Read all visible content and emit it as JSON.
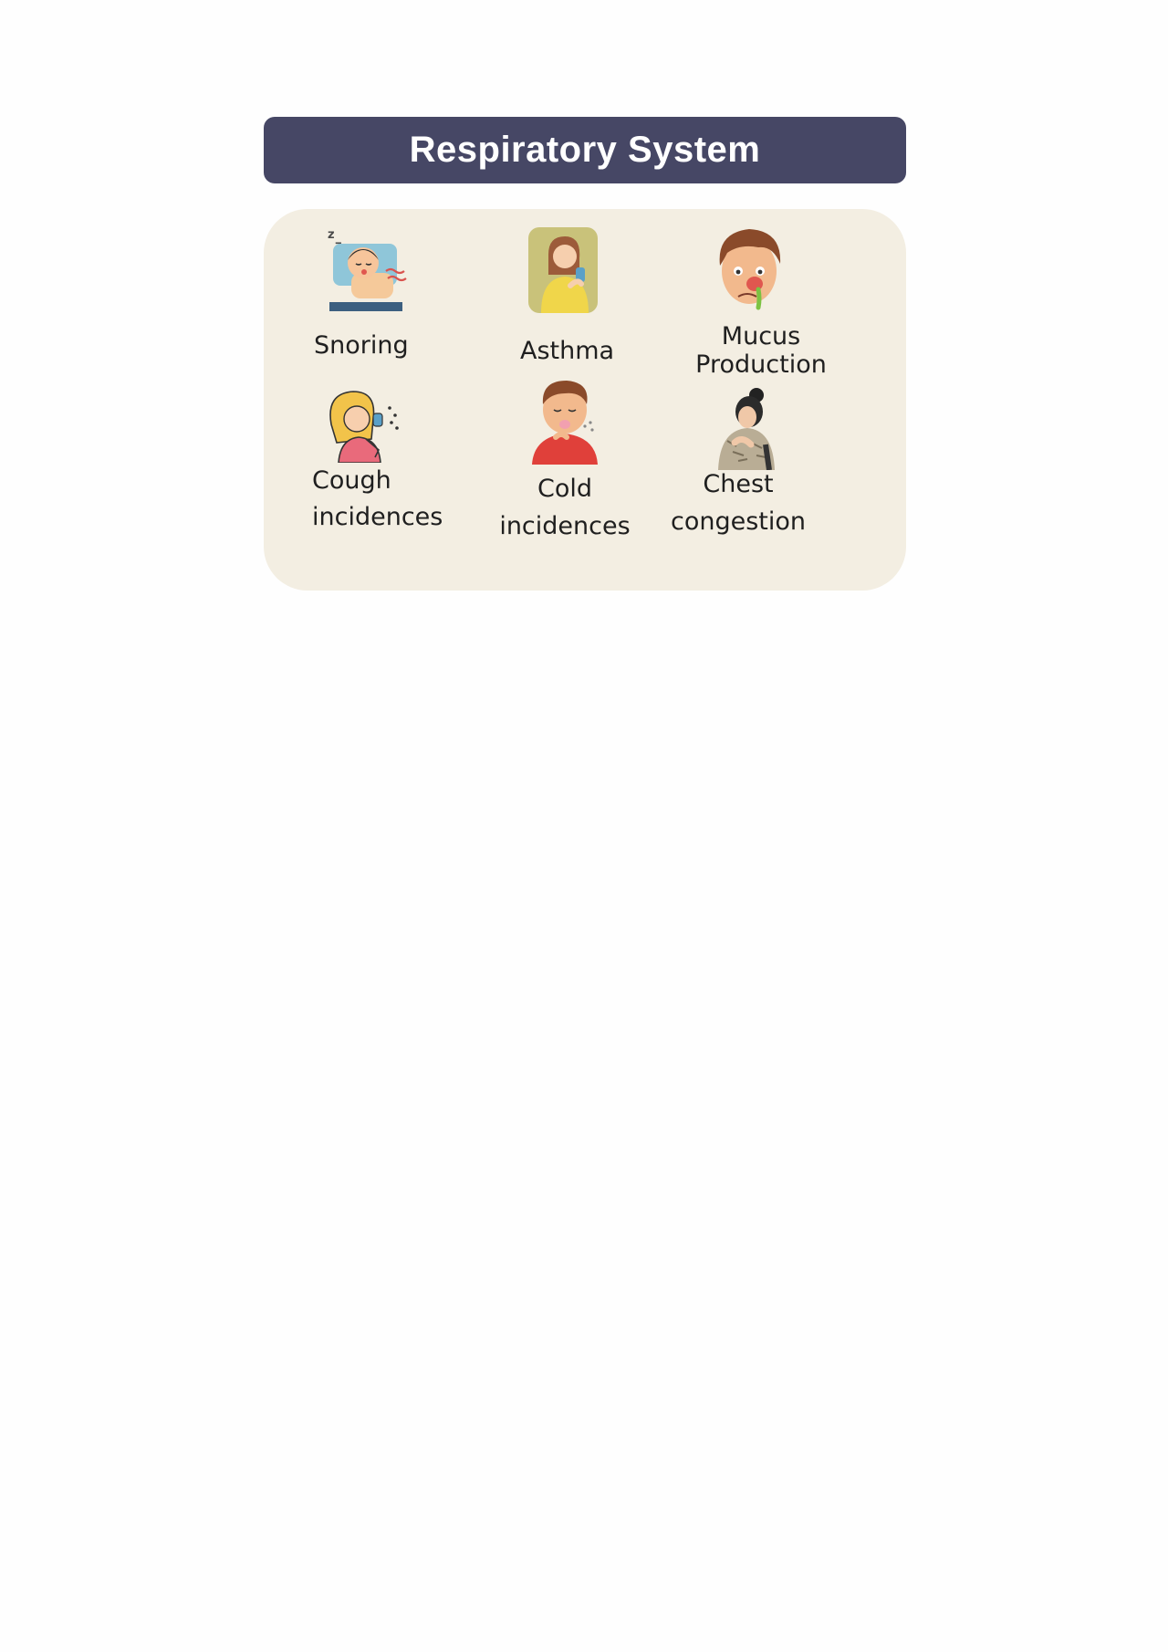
{
  "header": {
    "title": "Respiratory System"
  },
  "items": [
    {
      "icon": "snoring-icon",
      "label_lines": [
        "Snoring"
      ]
    },
    {
      "icon": "asthma-inhaler-icon",
      "label_lines": [
        "Asthma"
      ]
    },
    {
      "icon": "runny-nose-icon",
      "label_lines": [
        "Mucus",
        "Production"
      ]
    },
    {
      "icon": "coughing-woman-icon",
      "label_lines": [
        "Cough",
        "incidences"
      ]
    },
    {
      "icon": "sneezing-man-icon",
      "label_lines": [
        "Cold",
        "incidences"
      ]
    },
    {
      "icon": "chest-congestion-icon",
      "label_lines": [
        "Chest",
        "congestion"
      ]
    }
  ],
  "colors": {
    "header_bg": "#464765",
    "panel_bg": "#f3eee2",
    "page_bg": "#fefefe"
  }
}
